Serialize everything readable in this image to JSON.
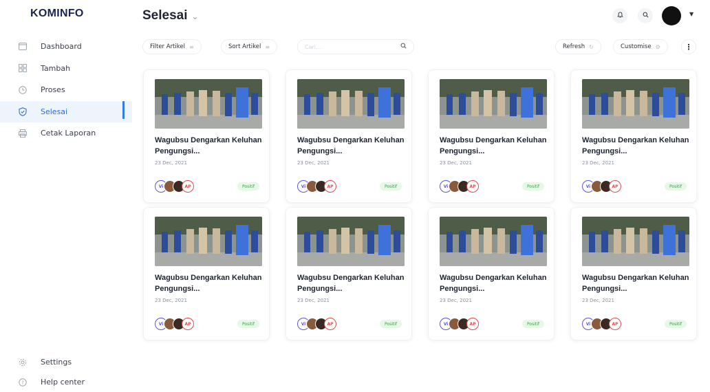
{
  "app": {
    "brand": "KOMINFO"
  },
  "sidebar": {
    "items": [
      {
        "label": "Dashboard",
        "icon": "dashboard-icon"
      },
      {
        "label": "Tambah",
        "icon": "add-grid-icon"
      },
      {
        "label": "Proses",
        "icon": "clock-icon"
      },
      {
        "label": "Selesai",
        "icon": "shield-check-icon",
        "active": true
      },
      {
        "label": "Cetak Laporan",
        "icon": "print-icon"
      }
    ],
    "bottom": [
      {
        "label": "Settings",
        "icon": "gear-icon"
      },
      {
        "label": "Help center",
        "icon": "help-icon"
      }
    ]
  },
  "header": {
    "title": "Selesai"
  },
  "toolbar": {
    "filter_label": "Filter Artikel",
    "sort_label": "Sort Artikel",
    "search_placeholder": "Cari...",
    "refresh_label": "Refresh",
    "customise_label": "Customise"
  },
  "cards": [
    {
      "title": "Wagubsu Dengarkan Keluhan Pengungsi...",
      "date": "23 Dec, 2021",
      "avatar_left": "Vi",
      "avatar_right": "AP",
      "status": "Positif"
    },
    {
      "title": "Wagubsu Dengarkan Keluhan Pengungsi...",
      "date": "23 Dec, 2021",
      "avatar_left": "Vi",
      "avatar_right": "AP",
      "status": "Positif"
    },
    {
      "title": "Wagubsu Dengarkan Keluhan Pengungsi...",
      "date": "23 Dec, 2021",
      "avatar_left": "Vi",
      "avatar_right": "AP",
      "status": "Positif"
    },
    {
      "title": "Wagubsu Dengarkan Keluhan Pengungsi...",
      "date": "23 Dec, 2021",
      "avatar_left": "Vi",
      "avatar_right": "AP",
      "status": "Positif"
    },
    {
      "title": "Wagubsu Dengarkan Keluhan Pengungsi...",
      "date": "23 Dec, 2021",
      "avatar_left": "Vi",
      "avatar_right": "AP",
      "status": "Positif"
    },
    {
      "title": "Wagubsu Dengarkan Keluhan Pengungsi...",
      "date": "23 Dec, 2021",
      "avatar_left": "Vi",
      "avatar_right": "AP",
      "status": "Positif"
    },
    {
      "title": "Wagubsu Dengarkan Keluhan Pengungsi...",
      "date": "23 Dec, 2021",
      "avatar_left": "Vi",
      "avatar_right": "AP",
      "status": "Positif"
    },
    {
      "title": "Wagubsu Dengarkan Keluhan Pengungsi...",
      "date": "23 Dec, 2021",
      "avatar_left": "Vi",
      "avatar_right": "AP",
      "status": "Positif"
    }
  ],
  "colors": {
    "accent": "#2e7ee6",
    "positive_bg": "#e7f7e8",
    "positive_text": "#3aa345",
    "brand": "#1c2550"
  }
}
